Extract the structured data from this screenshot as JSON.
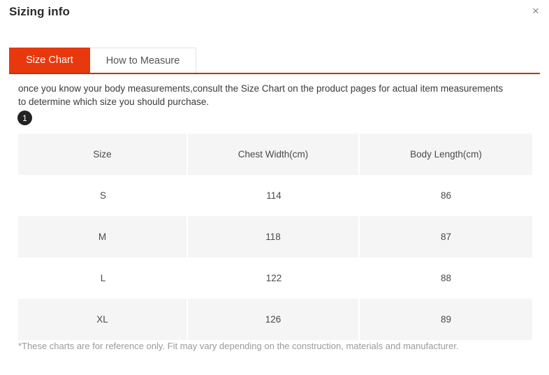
{
  "modal": {
    "title": "Sizing info",
    "close_label": "×",
    "close_icon": "close-icon"
  },
  "tabs": [
    {
      "label": "Size Chart",
      "active": true
    },
    {
      "label": "How to Measure",
      "active": false
    }
  ],
  "intro": {
    "text": "once you know your body measurements,consult the Size Chart on the product pages for actual item measurements to determine which size you should purchase."
  },
  "step_badge": {
    "number": "1"
  },
  "chart_data": {
    "type": "table",
    "title": "Size Chart",
    "columns": [
      "Size",
      "Chest Width(cm)",
      "Body Length(cm)"
    ],
    "rows": [
      [
        "S",
        "114",
        "86"
      ],
      [
        "M",
        "118",
        "87"
      ],
      [
        "L",
        "122",
        "88"
      ],
      [
        "XL",
        "126",
        "89"
      ]
    ]
  },
  "footnote": {
    "text": "*These charts are for reference only. Fit may vary depending on the construction, materials and manufacturer."
  },
  "colors": {
    "accent": "#e8380d",
    "accent_underline": "#b5380f",
    "row_shaded": "#f5f5f5",
    "badge": "#222222",
    "text": "#4a4a4a",
    "muted": "#9a9a9a"
  }
}
